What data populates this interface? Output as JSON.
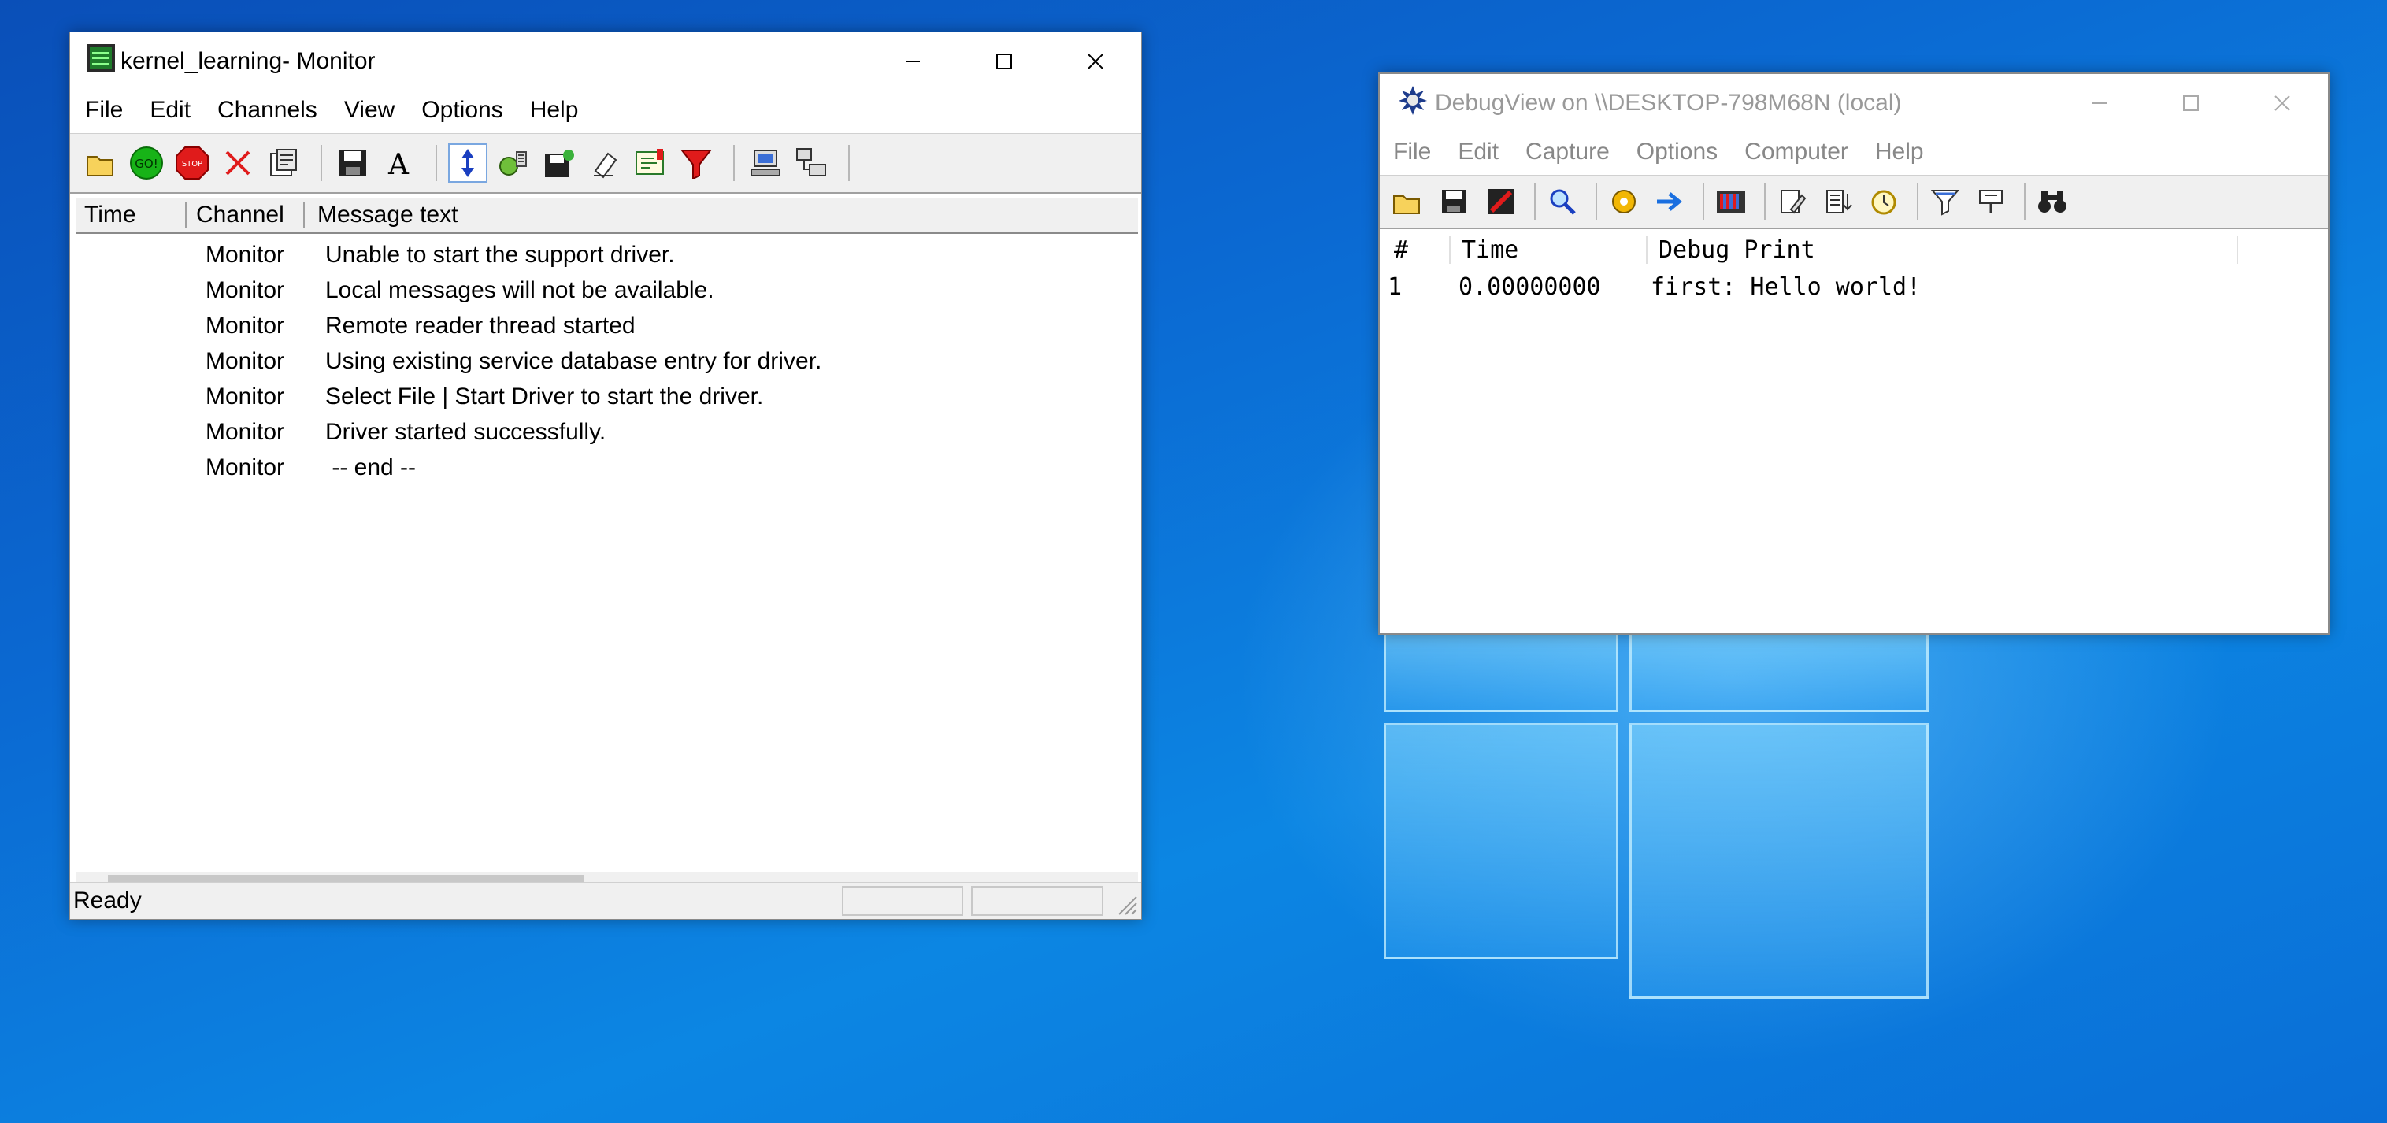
{
  "monitor": {
    "title": "kernel_learning- Monitor",
    "menu": [
      "File",
      "Edit",
      "Channels",
      "View",
      "Options",
      "Help"
    ],
    "columns": {
      "time": "Time",
      "channel": "Channel",
      "message": "Message text"
    },
    "rows": [
      {
        "time": "",
        "channel": "Monitor",
        "message": "Unable to start the support driver."
      },
      {
        "time": "",
        "channel": "Monitor",
        "message": "Local messages will not be available."
      },
      {
        "time": "",
        "channel": "Monitor",
        "message": "Remote reader thread started"
      },
      {
        "time": "",
        "channel": "Monitor",
        "message": "Using existing service database entry for driver."
      },
      {
        "time": "",
        "channel": "Monitor",
        "message": "Select File | Start Driver to start the driver."
      },
      {
        "time": "",
        "channel": "Monitor",
        "message": "Driver started successfully."
      },
      {
        "time": "",
        "channel": "Monitor",
        "message": " -- end --"
      }
    ],
    "status": "Ready",
    "go_label": "GO!",
    "stop_label": "STOP"
  },
  "debugview": {
    "title": "DebugView on \\\\DESKTOP-798M68N (local)",
    "menu": [
      "File",
      "Edit",
      "Capture",
      "Options",
      "Computer",
      "Help"
    ],
    "columns": {
      "num": "#",
      "time": "Time",
      "print": "Debug Print"
    },
    "rows": [
      {
        "num": "1",
        "time": "0.00000000",
        "print": "first: Hello world!"
      }
    ]
  },
  "colors": {
    "accent": "#0c86e3",
    "title_text_inactive": "#999999"
  }
}
